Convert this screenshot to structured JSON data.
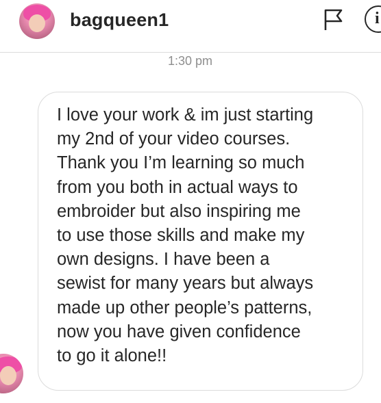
{
  "header": {
    "username": "bagqueen1",
    "flag_icon": "flag-icon",
    "info_icon": "info-icon",
    "info_glyph": "i"
  },
  "thread": {
    "timestamp": "1:30 pm",
    "messages": [
      {
        "sender": "bagqueen1",
        "text": "I love your work & im just starting\nmy 2nd of your video courses.\nThank you I’m learning so much\nfrom you both in actual ways to\nembroider but also inspiring me\nto use those skills and make my\nown designs. I have been a\nsewist for many years but always\nmade up other people’s patterns,\nnow you have given confidence\nto go it alone!!"
      }
    ]
  },
  "colors": {
    "text": "#262626",
    "timestamp": "#8e8e8e",
    "border": "#dbdbdb",
    "avatar_hair": "#ee4fa6"
  }
}
